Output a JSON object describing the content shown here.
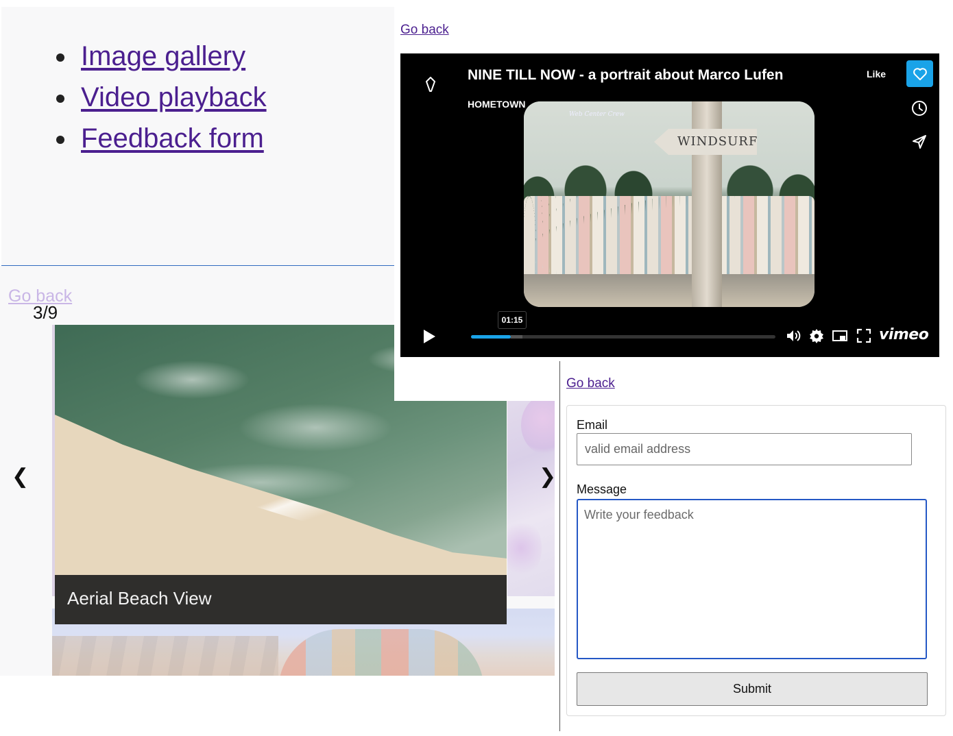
{
  "menu": {
    "items": [
      {
        "label": "Image gallery"
      },
      {
        "label": "Video playback"
      },
      {
        "label": "Feedback form"
      }
    ]
  },
  "gallery": {
    "back_label": "Go back",
    "counter": "3/9",
    "current_slide": 3,
    "total_slides": 9,
    "caption": "Aerial Beach View",
    "prev_arrow": "❮",
    "next_arrow": "❯"
  },
  "video": {
    "back_label": "Go back",
    "title": "NINE TILL NOW - a portrait about Marco Lufen",
    "channel": "HOMETOWN",
    "like_label": "Like",
    "current_time": "01:15",
    "progress_fraction": 0.13,
    "buffered_fraction": 0.17,
    "brand": "vimeo",
    "frame_sign_text": "WINDSURF",
    "frame_watermark": "Web Center Crew",
    "accent_color": "#1aa3e8"
  },
  "feedback": {
    "back_label": "Go back",
    "email_label": "Email",
    "email_placeholder": "valid email address",
    "message_label": "Message",
    "message_placeholder": "Write your feedback",
    "submit_label": "Submit"
  }
}
